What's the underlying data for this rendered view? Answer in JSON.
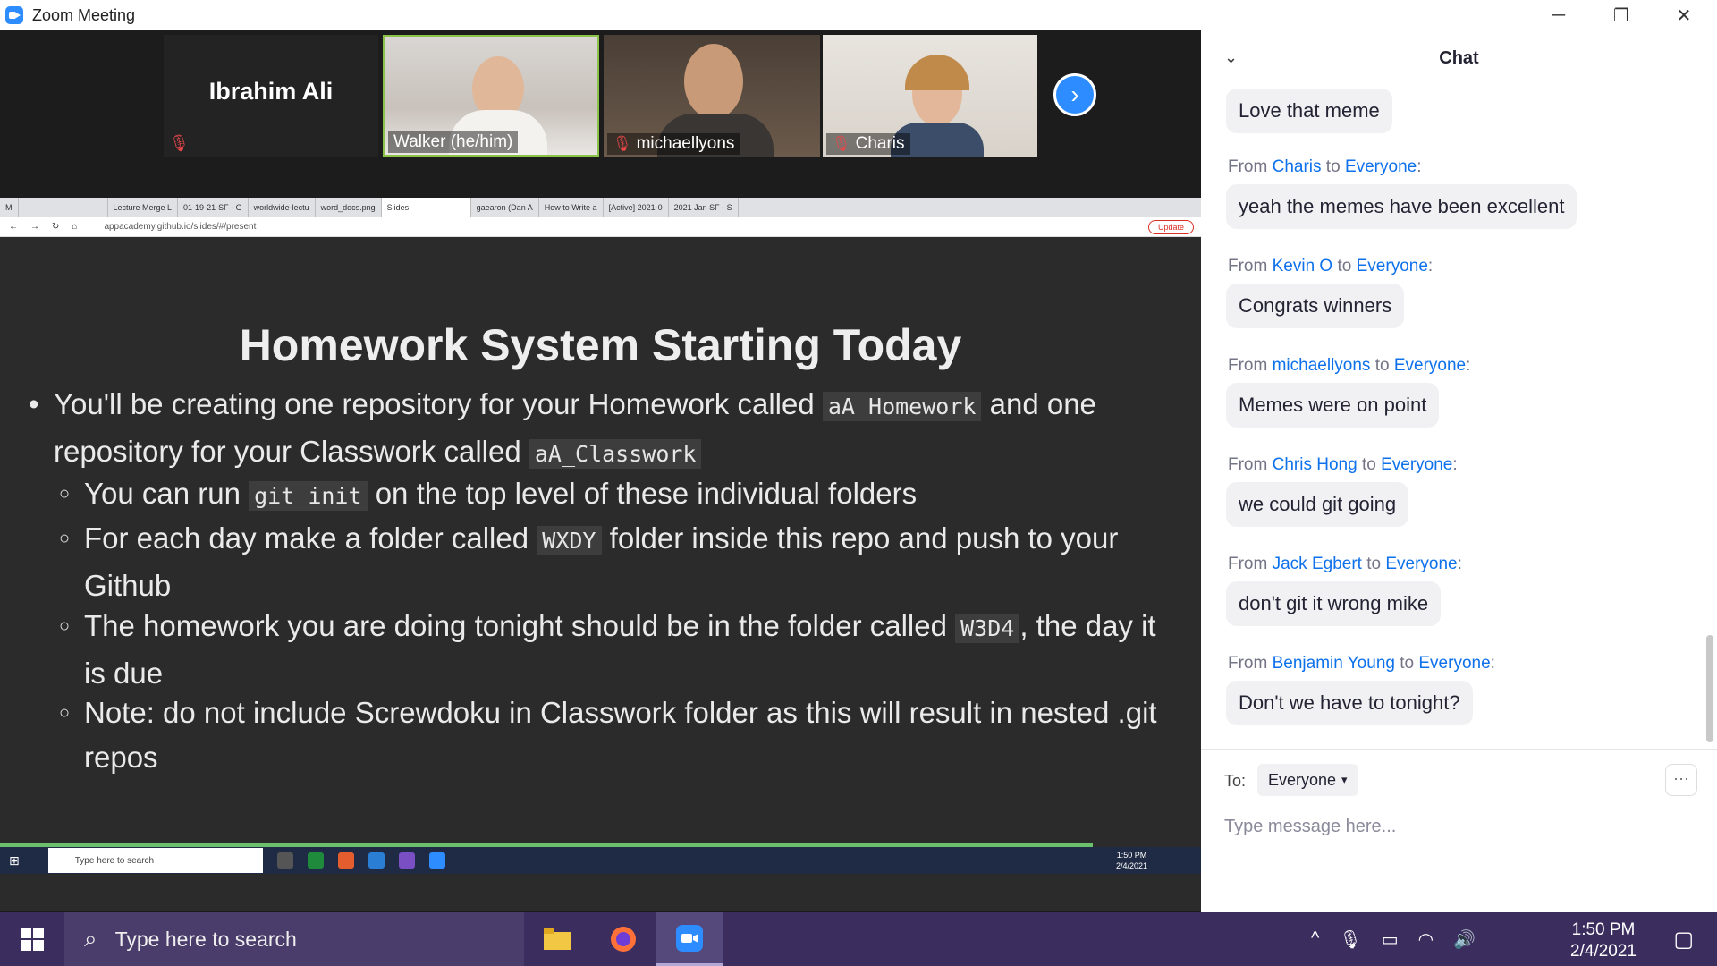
{
  "window": {
    "title": "Zoom Meeting",
    "minimize": "─",
    "restore": "❐",
    "close": "✕"
  },
  "participants": [
    {
      "name": "Ibrahim Ali",
      "muted": true
    },
    {
      "name": "Walker (he/him)",
      "muted": false
    },
    {
      "name": "michaellyons",
      "muted": true
    },
    {
      "name": "Charis",
      "muted": true
    }
  ],
  "browser": {
    "tabs": [
      "M",
      "Lecture Merge L",
      "01-19-21-SF - G",
      "worldwide-lectu",
      "word_docs.png",
      "Slides",
      "gaearon (Dan A",
      "How to Write a",
      "[Active] 2021-0",
      "2021 Jan SF - S"
    ],
    "url": "appacademy.github.io/slides/#/present",
    "update_label": "Update"
  },
  "slide": {
    "title": "Homework System Starting Today",
    "b1_text1": "You'll be creating one repository for your Homework called",
    "b1_code1": "aA_Homework",
    "b1_text2": "and one",
    "b1_text3": "repository for your Classwork called",
    "b1_code2": "aA_Classwork",
    "b2_text1": "You can run",
    "b2_code": "git init",
    "b2_text2": "on the top level of these individual folders",
    "b3_text1": "For each day make a folder called",
    "b3_code": "WXDY",
    "b3_text2": "folder inside this repo and push to your",
    "b3_text3": "Github",
    "b4_text1": "The homework you are doing tonight should be in the folder called",
    "b4_code": "W3D4",
    "b4_text2": ", the day it",
    "b4_text3": "is due",
    "b5_text1": "Note: do not include Screwdoku in Classwork folder as this will result in nested .git",
    "b5_text2": "repos"
  },
  "inner_taskbar": {
    "search": "Type here to search",
    "time": "1:50 PM",
    "date": "2/4/2021"
  },
  "chat": {
    "title": "Chat",
    "messages": [
      {
        "from": "",
        "text": "Love that meme"
      },
      {
        "from": "Charis",
        "text": "yeah the memes have been excellent"
      },
      {
        "from": "Kevin O",
        "text": "Congrats winners"
      },
      {
        "from": "michaellyons",
        "text": "Memes were on point"
      },
      {
        "from": "Chris Hong",
        "text": "we could git going"
      },
      {
        "from": "Jack Egbert",
        "text": "don't git it wrong mike"
      },
      {
        "from": "Benjamin Young",
        "text": "Don't we have to tonight?"
      }
    ],
    "from_label": "From",
    "to_word": "to",
    "everyone": "Everyone",
    "to_label": "To:",
    "recipient": "Everyone",
    "placeholder": "Type message here...",
    "more": "···"
  },
  "taskbar": {
    "search": "Type here to search",
    "time": "1:50 PM",
    "date": "2/4/2021"
  }
}
